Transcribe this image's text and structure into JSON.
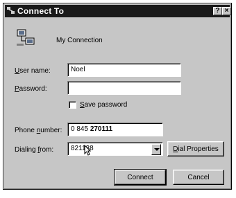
{
  "window": {
    "title": "Connect To",
    "help_btn": "?",
    "close_btn": "×"
  },
  "connection": {
    "name": "My Connection"
  },
  "form": {
    "user_name_label_pre": "",
    "user_name_label_hot": "U",
    "user_name_label_post": "ser name:",
    "user_name_value": "Noel",
    "password_label_pre": "",
    "password_label_hot": "P",
    "password_label_post": "assword:",
    "password_value": "",
    "save_password_pre": "",
    "save_password_hot": "S",
    "save_password_post": "ave password",
    "phone_label_pre": "Phone ",
    "phone_label_hot": "n",
    "phone_label_post": "umber:",
    "phone_value_plain": "0 845 ",
    "phone_value_selected": "270111",
    "dialing_from_label_pre": "Dialing ",
    "dialing_from_label_hot": "f",
    "dialing_from_label_post": "rom:",
    "dialing_from_value": "821138"
  },
  "buttons": {
    "dial_properties_hot": "D",
    "dial_properties_post": "ial Properties",
    "connect": "Connect",
    "cancel": "Cancel"
  },
  "colors": {
    "titlebar": "#1a1a1a",
    "face": "#c6c6c6"
  },
  "icons": {
    "title_icon": "computer-network-icon",
    "connection_icon": "dial-up-connection-icon"
  }
}
